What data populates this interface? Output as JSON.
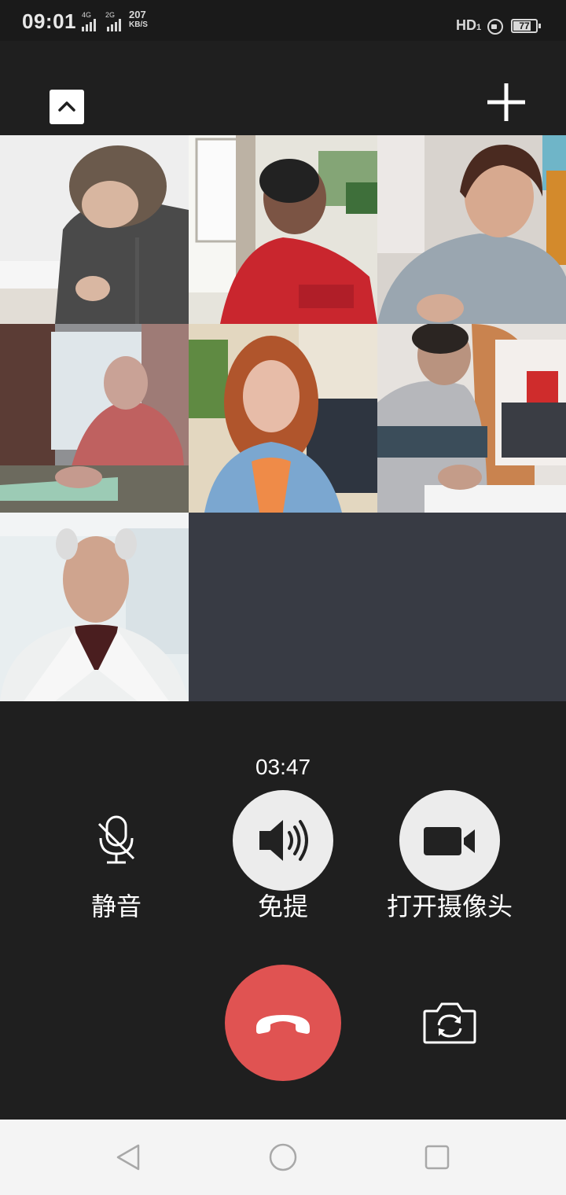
{
  "status_bar": {
    "time": "09:01",
    "sim1_label": "4G",
    "sim2_label": "2G",
    "network_speed_value": "207",
    "network_speed_unit": "KB/S",
    "hd_label": "HD",
    "hd_sim_index": "1",
    "battery_level": "77"
  },
  "top_bar": {
    "collapse_icon": "chevron-up-icon",
    "add_icon": "plus-icon"
  },
  "video_grid": {
    "tiles": [
      {
        "kind": "video",
        "background": "#efefef"
      },
      {
        "kind": "video",
        "background": "#e6e2da"
      },
      {
        "kind": "video",
        "background": "#ddd9d4"
      },
      {
        "kind": "video",
        "background": "#8a8f93"
      },
      {
        "kind": "video",
        "background": "#d9d2c5"
      },
      {
        "kind": "video",
        "background": "#d9d6d2"
      },
      {
        "kind": "video",
        "background": "#e5ebee"
      },
      {
        "kind": "empty",
        "background": "#383b44"
      },
      {
        "kind": "empty",
        "background": "#383b44"
      }
    ]
  },
  "call": {
    "timer": "03:47"
  },
  "controls": {
    "mute_label": "静音",
    "mute_icon": "mic-off-icon",
    "speaker_label": "免提",
    "speaker_icon": "speaker-icon",
    "camera_label": "打开摄像头",
    "camera_icon": "video-camera-icon",
    "hangup_icon": "phone-hangup-icon",
    "hangup_color": "#e05352",
    "switch_camera_icon": "camera-switch-icon"
  },
  "nav_bar": {
    "back_icon": "triangle-back-icon",
    "home_icon": "circle-home-icon",
    "recents_icon": "square-recents-icon"
  }
}
